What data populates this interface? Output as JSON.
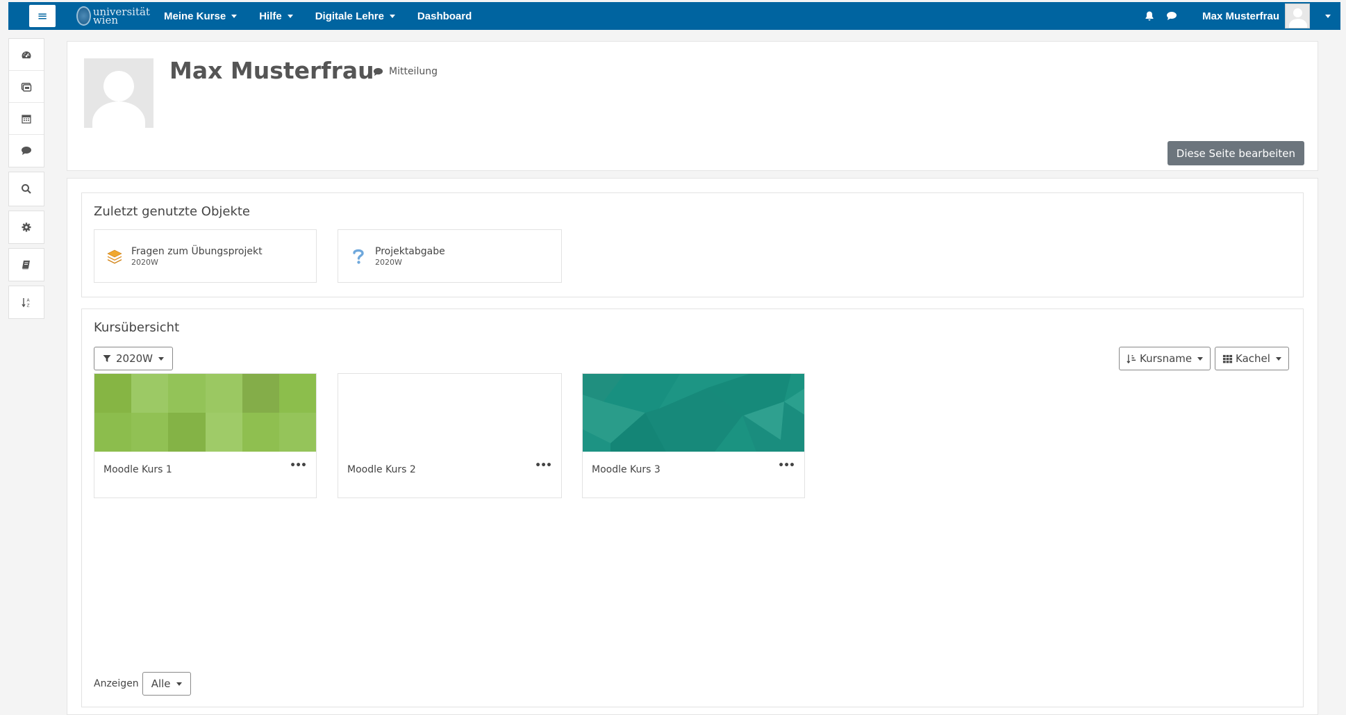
{
  "navbar": {
    "menu_icon": "≡",
    "logo_text": "universität wien",
    "items": [
      {
        "label": "Meine Kurse",
        "has_caret": true
      },
      {
        "label": "Hilfe",
        "has_caret": true
      },
      {
        "label": "Digitale Lehre",
        "has_caret": true
      },
      {
        "label": "Dashboard",
        "has_caret": false
      }
    ],
    "user_name": "Max Musterfrau",
    "icons": [
      "bell-icon",
      "chat-icon"
    ]
  },
  "rail": {
    "groups": [
      [
        "dashboard-gauge-icon",
        "courses-icon",
        "calendar-icon",
        "messages-icon"
      ],
      [
        "search-icon"
      ],
      [
        "settings-gear-icon"
      ],
      [
        "book-icon"
      ],
      [
        "sort-az-icon"
      ]
    ]
  },
  "profile": {
    "name": "Max Musterfrau",
    "message_label": "Mitteilung",
    "edit_page_label": "Diese Seite bearbeiten"
  },
  "recent": {
    "title": "Zuletzt genutzte Objekte",
    "items": [
      {
        "title": "Fragen zum Übungsprojekt",
        "subtitle": "2020W",
        "icon": "layers-icon"
      },
      {
        "title": "Projektabgabe",
        "subtitle": "2020W",
        "icon": "question-icon"
      }
    ]
  },
  "courses": {
    "title": "Kursübersicht",
    "filter_label": "2020W",
    "sort_label": "Kursname",
    "view_label": "Kachel",
    "items": [
      {
        "name": "Moodle Kurs 1",
        "menu": "•••",
        "image": "green-tiles"
      },
      {
        "name": "Moodle Kurs 2",
        "menu": "•••",
        "image": "none"
      },
      {
        "name": "Moodle Kurs 3",
        "menu": "•••",
        "image": "teal-polygons"
      }
    ],
    "show_label": "Anzeigen",
    "show_value": "Alle"
  },
  "colors": {
    "navbar": "#0064a0",
    "edit_button": "#6c757d",
    "course1_green": "#8bbf4c",
    "course3_teal": "#1a9080"
  }
}
